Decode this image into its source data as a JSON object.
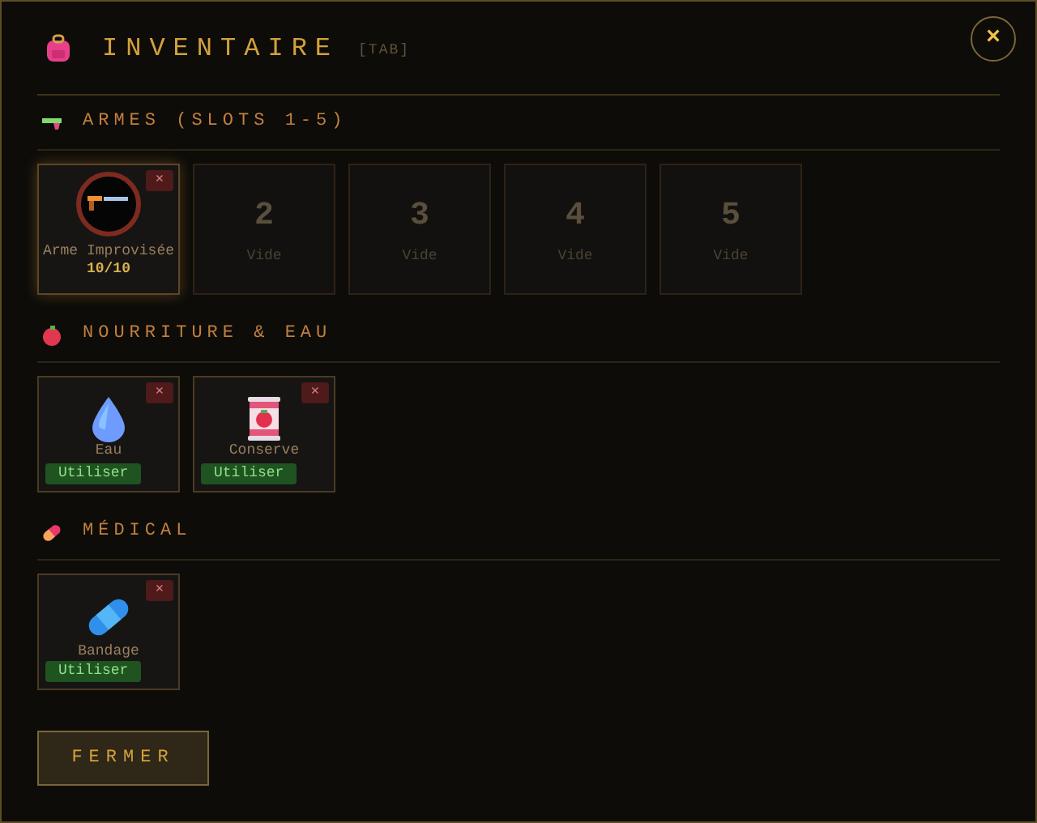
{
  "title": "INVENTAIRE",
  "shortcut": "[TAB]",
  "close": "×",
  "sections": [
    {
      "kind": "weapons",
      "title": "ARMES (SLOTS 1-5)",
      "slots": [
        {
          "kind": "item",
          "name": "Arme Improvisée",
          "ammo": "10/10",
          "remove": "×"
        },
        {
          "kind": "empty",
          "number": "2",
          "label": "Vide"
        },
        {
          "kind": "empty",
          "number": "3",
          "label": "Vide"
        },
        {
          "kind": "empty",
          "number": "4",
          "label": "Vide"
        },
        {
          "kind": "empty",
          "number": "5",
          "label": "Vide"
        }
      ]
    },
    {
      "kind": "food",
      "title": "NOURRITURE & EAU",
      "slots": [
        {
          "kind": "water",
          "name": "Eau",
          "remove": "×",
          "action": "Utiliser"
        },
        {
          "kind": "can",
          "name": "Conserve",
          "remove": "×",
          "action": "Utiliser"
        }
      ]
    },
    {
      "kind": "medical",
      "title": "MÉDICAL",
      "slots": [
        {
          "kind": "bandage",
          "name": "Bandage",
          "remove": "×",
          "action": "Utiliser"
        }
      ]
    }
  ],
  "footer_button": "FERMER"
}
